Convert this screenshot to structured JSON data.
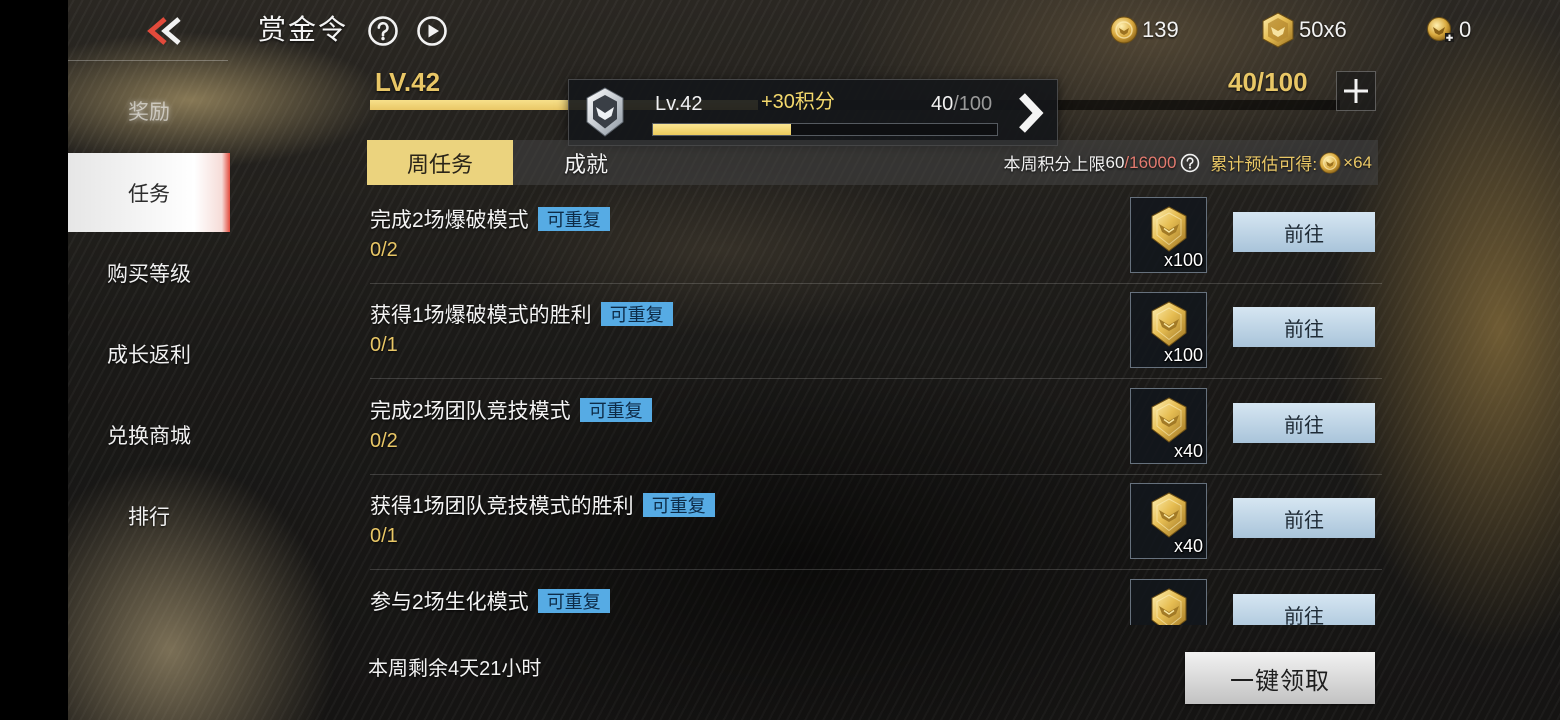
{
  "colors": {
    "gold": "#e9c766",
    "gold_bright": "#f3d86c",
    "badge": "#56abe4",
    "tab_active": "#ebd37e",
    "button": "#bfd6ea",
    "accent_red": "#e24a3b",
    "limit_red": "#e47b70"
  },
  "header": {
    "back_icon": "double-chevron-left-icon",
    "title": "赏金令",
    "help_icon": "question-circle-icon",
    "play_icon": "play-circle-icon",
    "currencies": [
      {
        "icon": "coin-icon",
        "value": "139"
      },
      {
        "icon": "crystal-badge-icon",
        "value": "50x6"
      },
      {
        "icon": "emblem-plus-icon",
        "value": "0"
      }
    ]
  },
  "level": {
    "label": "LV.42",
    "progress_text": "40/100",
    "progress": 0.4,
    "add_icon": "plus-icon"
  },
  "popup": {
    "icon": "rank-shield-icon",
    "level": "Lv.42",
    "gain": "+30积分",
    "current": "40",
    "total": "/100",
    "progress": 0.4,
    "arrow_icon": "chevron-right-icon"
  },
  "sidebar": {
    "items": [
      {
        "label": "奖励",
        "active": false
      },
      {
        "label": "任务",
        "active": true
      },
      {
        "label": "购买等级",
        "active": false
      },
      {
        "label": "成长返利",
        "active": false
      },
      {
        "label": "兑换商城",
        "active": false
      },
      {
        "label": "排行",
        "active": false
      }
    ]
  },
  "tabs": [
    {
      "label": "周任务",
      "active": true
    },
    {
      "label": "成就",
      "active": false
    }
  ],
  "weekly": {
    "cap_label": "本周积分上限",
    "cap_current": "60",
    "cap_max": "/16000",
    "help_icon": "question-circle-icon",
    "estimate_label": "累计预估可得:",
    "estimate_icon": "coin-icon",
    "estimate_value": "×64"
  },
  "tasks": [
    {
      "title": "完成2场爆破模式",
      "badge": "可重复",
      "progress": "0/2",
      "reward_icon": "shield-token-icon",
      "reward": "x100",
      "action": "前往"
    },
    {
      "title": "获得1场爆破模式的胜利",
      "badge": "可重复",
      "progress": "0/1",
      "reward_icon": "shield-token-icon",
      "reward": "x100",
      "action": "前往"
    },
    {
      "title": "完成2场团队竞技模式",
      "badge": "可重复",
      "progress": "0/2",
      "reward_icon": "shield-token-icon",
      "reward": "x40",
      "action": "前往"
    },
    {
      "title": "获得1场团队竞技模式的胜利",
      "badge": "可重复",
      "progress": "0/1",
      "reward_icon": "shield-token-icon",
      "reward": "x40",
      "action": "前往"
    },
    {
      "title": "参与2场生化模式",
      "badge": "可重复",
      "reward_icon": "shield-token-icon",
      "action": "前往"
    }
  ],
  "footer": {
    "remaining": "本周剩余4天21小时",
    "claim_all": "一键领取"
  }
}
